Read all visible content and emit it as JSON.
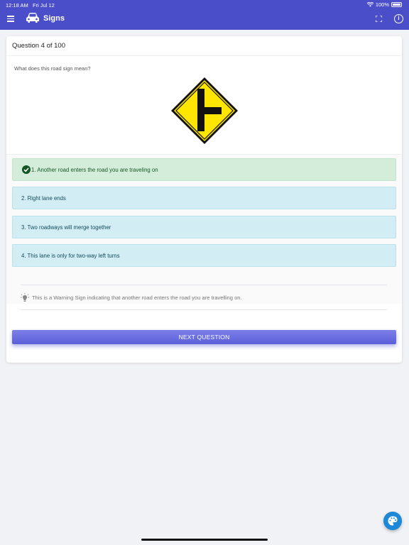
{
  "status": {
    "time": "12:18 AM",
    "date": "Fri Jul 12",
    "battery": "100%"
  },
  "header": {
    "title": "Signs",
    "icons": [
      "menu-icon",
      "car-icon",
      "expand-icon",
      "info-icon"
    ]
  },
  "question": {
    "progress": "Question 4 of 100",
    "text": "What does this road sign mean?",
    "sign": "side-road-warning-sign"
  },
  "answers": [
    {
      "label": "1. Another road enters the road you are traveling on",
      "correct": true
    },
    {
      "label": "2. Right lane ends",
      "correct": false
    },
    {
      "label": "3. Two roadways will merge together",
      "correct": false
    },
    {
      "label": "4. This lane is only for two-way left turns",
      "correct": false
    }
  ],
  "hint": {
    "icon": "lightbulb-icon",
    "text": "This is a Warning Sign indicating that another road enters the road you are travelling on."
  },
  "actions": {
    "next_label": "NEXT QUESTION"
  },
  "fab": {
    "icon": "palette-icon"
  },
  "colors": {
    "header": "#4a4fc9",
    "correct": "#d4edda",
    "answer": "#d2edf3",
    "accent": "#5b5fd8",
    "sign": "#ffe600"
  }
}
